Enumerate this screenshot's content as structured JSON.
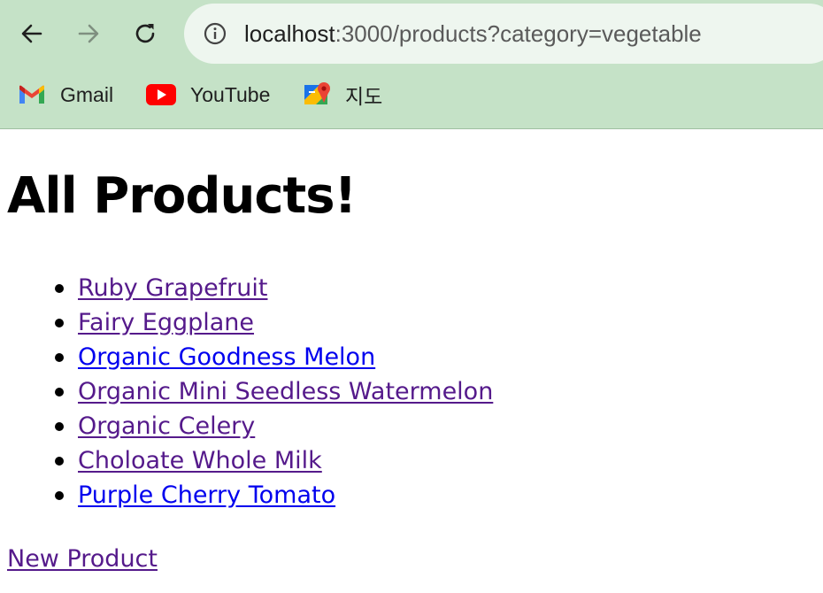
{
  "browser": {
    "url_host": "localhost",
    "url_rest": ":3000/products?category=vegetable",
    "bookmarks": [
      {
        "label": "Gmail",
        "icon": "gmail-icon"
      },
      {
        "label": "YouTube",
        "icon": "youtube-icon"
      },
      {
        "label": "지도",
        "icon": "google-maps-icon"
      }
    ],
    "chrome_color": "#c5e2c7"
  },
  "page": {
    "title": "All Products!",
    "products": [
      {
        "name": "Ruby Grapefruit",
        "visited": true
      },
      {
        "name": "Fairy Eggplane",
        "visited": true
      },
      {
        "name": "Organic Goodness Melon",
        "visited": false
      },
      {
        "name": "Organic Mini Seedless Watermelon",
        "visited": true
      },
      {
        "name": "Organic Celery",
        "visited": true
      },
      {
        "name": "Choloate Whole Milk",
        "visited": true
      },
      {
        "name": "Purple Cherry Tomato",
        "visited": false
      }
    ],
    "new_product_label": "New Product",
    "colors": {
      "visited_link": "#551a8b",
      "unvisited_link": "#0000ee"
    }
  }
}
